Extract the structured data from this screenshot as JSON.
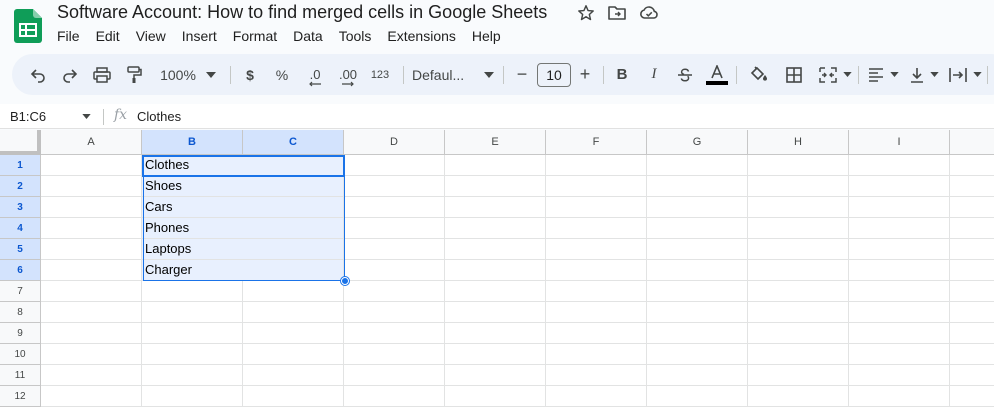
{
  "app": {
    "title": "Software Account: How to find merged cells in Google Sheets",
    "icons": [
      "sheets-logo",
      "star-icon",
      "move-to-folder-icon",
      "cloud-status-icon"
    ],
    "accent_color": "#0f9d58"
  },
  "menu": [
    "File",
    "Edit",
    "View",
    "Insert",
    "Format",
    "Data",
    "Tools",
    "Extensions",
    "Help"
  ],
  "toolbar": {
    "zoom": "100%",
    "currency": "$",
    "percent": "%",
    "decrease_decimal": ".0",
    "increase_decimal": ".00",
    "number_format": "123",
    "font": "Defaul...",
    "minus": "−",
    "font_size": "10",
    "plus": "+",
    "bold": "B",
    "italic": "I"
  },
  "formula_bar": {
    "name_box": "B1:C6",
    "fx": "fx",
    "content": "Clothes"
  },
  "grid": {
    "columns": [
      "A",
      "B",
      "C",
      "D",
      "E",
      "F",
      "G",
      "H",
      "I"
    ],
    "rows": [
      "1",
      "2",
      "3",
      "4",
      "5",
      "6",
      "7",
      "8",
      "9",
      "10",
      "11",
      "12"
    ],
    "selected_range": "B1:C6",
    "merged_values": [
      "Clothes",
      "Shoes",
      "Cars",
      "Phones",
      "Laptops",
      "Charger"
    ],
    "selection_color": "#1a73e8"
  }
}
